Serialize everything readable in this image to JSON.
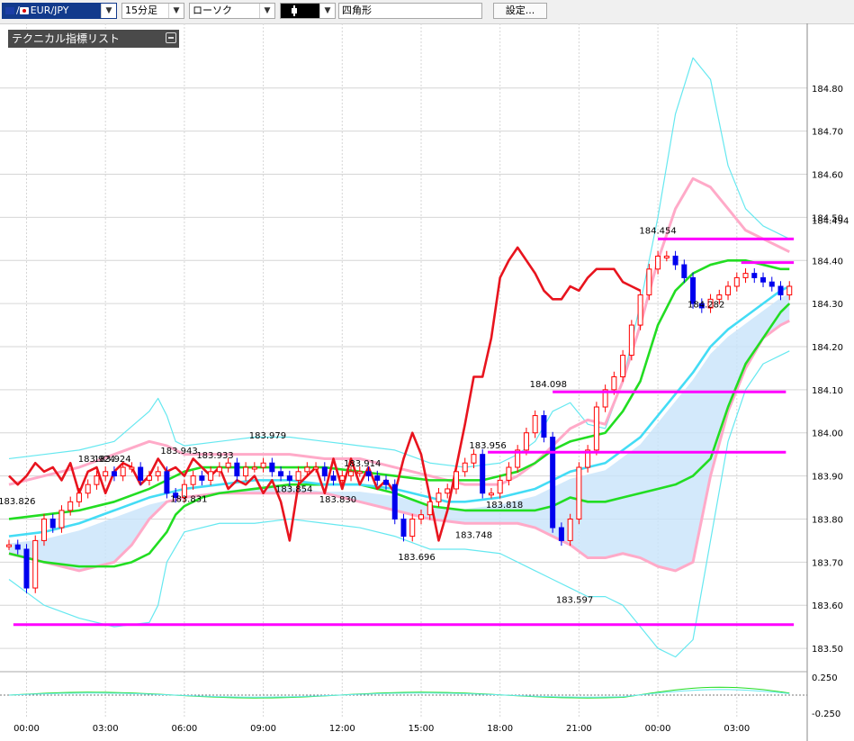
{
  "toolbar": {
    "pair": "EUR/JPY",
    "pair_flag_separator": "/",
    "timeframe": "15分足",
    "chart_style": "ローソク",
    "drawing_tool_icon": "bar-cursor-icon",
    "drawing_shape": "四角形",
    "settings_label": "設定..."
  },
  "indicator_panel": {
    "title": "テクニカル指標リスト"
  },
  "colors": {
    "price_line": "#e8141e",
    "bollinger_inner": "#ffaac8",
    "bollinger_outer": "#66e8f0",
    "ema_green": "#22dd22",
    "ema_cyan": "#44dcf5",
    "horizontal_lines": "#ff00ff",
    "cloud": "#c8e4fa",
    "candle_up": "#ff0000",
    "candle_down": "#0000ee"
  },
  "chart_data": {
    "type": "line",
    "title": "",
    "xlabel": "",
    "ylabel": "",
    "ylim": [
      183.45,
      184.95
    ],
    "yticks": [
      "184.80",
      "184.70",
      "184.60",
      "184.50",
      "184.40",
      "184.30",
      "184.20",
      "184.10",
      "184.00",
      "183.90",
      "183.80",
      "183.70",
      "183.60",
      "183.50"
    ],
    "current_price_label": "184.494",
    "xticks": [
      "00:00",
      "03:00",
      "06:00",
      "09:00",
      "12:00",
      "15:00",
      "18:00",
      "21:00",
      "00:00",
      "03:00"
    ],
    "xtick_pos": [
      2,
      11,
      20,
      29,
      38,
      47,
      56,
      65,
      74,
      83
    ],
    "x_max": 90,
    "oscillator": {
      "yticks": [
        "0.250",
        "-0.250"
      ],
      "ylim": [
        -0.3,
        0.3
      ]
    },
    "horizontal_levels": [
      {
        "from": 0.5,
        "to": 89.5,
        "y": 183.555
      },
      {
        "from": 54.6,
        "to": 88.6,
        "y": 183.955
      },
      {
        "from": 62.0,
        "to": 88.6,
        "y": 184.095
      },
      {
        "from": 74.0,
        "to": 89.5,
        "y": 184.45
      },
      {
        "from": 83.5,
        "to": 89.5,
        "y": 184.395
      }
    ],
    "annotations": [
      {
        "text": "183.826",
        "x": 0.9,
        "y": 183.826
      },
      {
        "text": "183.924",
        "x": 10.0,
        "y": 183.924
      },
      {
        "text": "183.924",
        "x": 11.8,
        "y": 183.924
      },
      {
        "text": "183.943",
        "x": 19.4,
        "y": 183.943
      },
      {
        "text": "183.933",
        "x": 23.5,
        "y": 183.933
      },
      {
        "text": "183.831",
        "x": 20.5,
        "y": 183.831
      },
      {
        "text": "183.979",
        "x": 29.5,
        "y": 183.979
      },
      {
        "text": "183.854",
        "x": 32.5,
        "y": 183.854
      },
      {
        "text": "183.914",
        "x": 40.3,
        "y": 183.914
      },
      {
        "text": "183.830",
        "x": 37.5,
        "y": 183.83
      },
      {
        "text": "183.696",
        "x": 46.5,
        "y": 183.696
      },
      {
        "text": "183.748",
        "x": 53.0,
        "y": 183.748
      },
      {
        "text": "183.956",
        "x": 54.6,
        "y": 183.956
      },
      {
        "text": "183.818",
        "x": 56.5,
        "y": 183.818
      },
      {
        "text": "184.098",
        "x": 61.5,
        "y": 184.098
      },
      {
        "text": "183.597",
        "x": 64.5,
        "y": 183.597
      },
      {
        "text": "184.454",
        "x": 74.0,
        "y": 184.454
      },
      {
        "text": "184.282",
        "x": 79.5,
        "y": 184.282
      }
    ],
    "series": [
      {
        "role": "bb_outer_upper",
        "x": [
          0,
          4,
          8,
          12,
          16,
          17,
          18,
          19,
          20,
          24,
          28,
          32,
          36,
          40,
          44,
          48,
          52,
          56,
          58,
          60,
          62,
          64,
          66,
          68,
          70,
          72,
          74,
          76,
          78,
          80,
          82,
          84,
          86,
          88,
          89
        ],
        "values": [
          183.94,
          183.95,
          183.96,
          183.98,
          184.05,
          184.08,
          184.04,
          183.98,
          183.97,
          183.98,
          183.99,
          183.99,
          183.98,
          183.97,
          183.96,
          183.93,
          183.92,
          183.93,
          183.95,
          183.98,
          184.05,
          184.07,
          184.02,
          184.01,
          184.12,
          184.3,
          184.5,
          184.74,
          184.87,
          184.82,
          184.62,
          184.52,
          184.48,
          184.46,
          184.45
        ]
      },
      {
        "role": "bb_inner_upper",
        "x": [
          0,
          4,
          8,
          12,
          16,
          18,
          20,
          24,
          28,
          32,
          36,
          40,
          44,
          48,
          52,
          56,
          58,
          60,
          62,
          64,
          66,
          68,
          70,
          72,
          74,
          76,
          78,
          80,
          82,
          84,
          86,
          88,
          89
        ],
        "values": [
          183.88,
          183.9,
          183.92,
          183.95,
          183.98,
          183.97,
          183.95,
          183.95,
          183.95,
          183.95,
          183.94,
          183.94,
          183.92,
          183.9,
          183.88,
          183.88,
          183.9,
          183.93,
          183.97,
          184.01,
          184.03,
          184.02,
          184.12,
          184.25,
          184.4,
          184.52,
          184.59,
          184.57,
          184.52,
          184.47,
          184.45,
          184.43,
          184.42
        ]
      },
      {
        "role": "bb_inner_lower",
        "x": [
          0,
          4,
          8,
          12,
          14,
          16,
          18,
          20,
          24,
          28,
          32,
          36,
          40,
          44,
          48,
          52,
          56,
          58,
          60,
          62,
          64,
          66,
          68,
          70,
          72,
          74,
          76,
          78,
          80,
          82,
          84,
          86,
          88,
          89
        ],
        "values": [
          183.72,
          183.7,
          183.68,
          183.7,
          183.74,
          183.8,
          183.84,
          183.85,
          183.86,
          183.86,
          183.86,
          183.86,
          183.84,
          183.82,
          183.8,
          183.79,
          183.79,
          183.79,
          183.78,
          183.76,
          183.74,
          183.71,
          183.71,
          183.72,
          183.71,
          183.69,
          183.68,
          183.7,
          183.9,
          184.05,
          184.15,
          184.22,
          184.25,
          184.26
        ]
      },
      {
        "role": "bb_outer_lower",
        "x": [
          0,
          4,
          8,
          12,
          16,
          17,
          18,
          20,
          24,
          28,
          32,
          36,
          40,
          44,
          48,
          52,
          56,
          58,
          60,
          62,
          64,
          66,
          68,
          70,
          72,
          74,
          76,
          78,
          80,
          82,
          84,
          86,
          88,
          89
        ],
        "values": [
          183.66,
          183.6,
          183.57,
          183.55,
          183.56,
          183.6,
          183.7,
          183.77,
          183.79,
          183.79,
          183.8,
          183.79,
          183.78,
          183.76,
          183.73,
          183.73,
          183.72,
          183.7,
          183.68,
          183.66,
          183.64,
          183.62,
          183.62,
          183.6,
          183.55,
          183.5,
          183.48,
          183.52,
          183.75,
          183.98,
          184.1,
          184.16,
          184.18,
          184.19
        ]
      },
      {
        "role": "ema_green_fast",
        "x": [
          0,
          4,
          8,
          12,
          16,
          18,
          20,
          22,
          24,
          28,
          32,
          36,
          40,
          44,
          48,
          52,
          54,
          56,
          58,
          60,
          62,
          64,
          66,
          68,
          70,
          72,
          74,
          76,
          78,
          80,
          82,
          84,
          86,
          88,
          89
        ],
        "values": [
          183.8,
          183.81,
          183.82,
          183.84,
          183.87,
          183.89,
          183.91,
          183.92,
          183.92,
          183.92,
          183.92,
          183.92,
          183.91,
          183.9,
          183.89,
          183.89,
          183.89,
          183.9,
          183.91,
          183.93,
          183.96,
          183.98,
          183.99,
          184.0,
          184.05,
          184.12,
          184.25,
          184.33,
          184.37,
          184.39,
          184.4,
          184.4,
          184.39,
          184.38,
          184.38
        ]
      },
      {
        "role": "ema_green_slow",
        "x": [
          0,
          4,
          8,
          12,
          14,
          16,
          18,
          19,
          20,
          22,
          24,
          28,
          32,
          36,
          40,
          44,
          48,
          52,
          56,
          58,
          60,
          62,
          64,
          66,
          68,
          70,
          72,
          74,
          76,
          78,
          80,
          82,
          84,
          86,
          88,
          89
        ],
        "values": [
          183.72,
          183.7,
          183.69,
          183.69,
          183.7,
          183.72,
          183.77,
          183.81,
          183.83,
          183.85,
          183.86,
          183.87,
          183.88,
          183.88,
          183.88,
          183.86,
          183.83,
          183.82,
          183.82,
          183.82,
          183.82,
          183.83,
          183.85,
          183.84,
          183.84,
          183.85,
          183.86,
          183.87,
          183.88,
          183.9,
          183.94,
          184.06,
          184.16,
          184.22,
          184.28,
          184.3
        ]
      },
      {
        "role": "ema_cyan",
        "x": [
          0,
          4,
          8,
          12,
          16,
          20,
          24,
          28,
          32,
          36,
          40,
          44,
          48,
          50,
          52,
          56,
          58,
          60,
          62,
          64,
          66,
          68,
          70,
          72,
          74,
          76,
          78,
          80,
          82,
          84,
          86,
          88,
          89
        ],
        "values": [
          183.76,
          183.77,
          183.79,
          183.82,
          183.85,
          183.87,
          183.88,
          183.89,
          183.89,
          183.88,
          183.88,
          183.87,
          183.85,
          183.84,
          183.84,
          183.85,
          183.86,
          183.87,
          183.89,
          183.91,
          183.92,
          183.93,
          183.96,
          183.99,
          184.04,
          184.09,
          184.14,
          184.2,
          184.24,
          184.27,
          184.3,
          184.33,
          184.34
        ]
      },
      {
        "role": "price_line_red",
        "x": [
          0,
          1,
          2,
          3,
          4,
          5,
          6,
          7,
          8,
          9,
          10,
          11,
          12,
          13,
          14,
          15,
          16,
          17,
          18,
          19,
          20,
          21,
          22,
          23,
          24,
          25,
          26,
          27,
          28,
          29,
          30,
          31,
          32,
          33,
          34,
          35,
          36,
          37,
          38,
          39,
          40,
          41,
          42,
          43,
          44,
          45,
          46,
          47,
          48,
          49,
          50,
          51,
          52,
          53,
          54,
          55,
          56,
          57,
          58,
          59,
          60,
          61,
          62,
          63,
          64,
          65,
          66,
          67,
          68,
          69,
          70,
          71,
          72
        ],
        "values": [
          183.9,
          183.88,
          183.9,
          183.93,
          183.91,
          183.92,
          183.89,
          183.93,
          183.86,
          183.91,
          183.92,
          183.86,
          183.91,
          183.93,
          183.92,
          183.88,
          183.9,
          183.94,
          183.91,
          183.92,
          183.9,
          183.94,
          183.92,
          183.9,
          183.92,
          183.87,
          183.89,
          183.88,
          183.9,
          183.86,
          183.89,
          183.84,
          183.75,
          183.88,
          183.9,
          183.92,
          183.86,
          183.94,
          183.87,
          183.94,
          183.88,
          183.92,
          183.87,
          183.89,
          183.86,
          183.94,
          184.0,
          183.95,
          183.85,
          183.75,
          183.82,
          183.92,
          184.02,
          184.13,
          184.13,
          184.22,
          184.36,
          184.4,
          184.43,
          184.4,
          184.37,
          184.33,
          184.31,
          184.31,
          184.34,
          184.33,
          184.36,
          184.38,
          184.38,
          184.38,
          184.35,
          184.34,
          184.33
        ]
      },
      {
        "role": "candles",
        "x": [
          0,
          1,
          2,
          3,
          4,
          5,
          6,
          7,
          8,
          9,
          10,
          11,
          12,
          13,
          14,
          15,
          16,
          17,
          18,
          19,
          20,
          21,
          22,
          23,
          24,
          25,
          26,
          27,
          28,
          29,
          30,
          31,
          32,
          33,
          34,
          35,
          36,
          37,
          38,
          39,
          40,
          41,
          42,
          43,
          44,
          45,
          46,
          47,
          48,
          49,
          50,
          51,
          52,
          53,
          54,
          55,
          56,
          57,
          58,
          59,
          60,
          61,
          62,
          63,
          64,
          65,
          66,
          67,
          68,
          69,
          70,
          71,
          72,
          73,
          74,
          75,
          76,
          77,
          78,
          79,
          80,
          81,
          82,
          83,
          84,
          85,
          86,
          87,
          88,
          89
        ],
        "values": [
          183.74,
          183.73,
          183.64,
          183.75,
          183.8,
          183.78,
          183.82,
          183.84,
          183.86,
          183.88,
          183.9,
          183.91,
          183.9,
          183.92,
          183.92,
          183.89,
          183.9,
          183.91,
          183.86,
          183.85,
          183.88,
          183.9,
          183.89,
          183.91,
          183.92,
          183.93,
          183.9,
          183.92,
          183.92,
          183.93,
          183.91,
          183.9,
          183.89,
          183.91,
          183.92,
          183.92,
          183.9,
          183.89,
          183.9,
          183.91,
          183.91,
          183.9,
          183.89,
          183.88,
          183.8,
          183.76,
          183.8,
          183.81,
          183.84,
          183.86,
          183.87,
          183.91,
          183.93,
          183.95,
          183.86,
          183.86,
          183.89,
          183.92,
          183.96,
          184.0,
          184.04,
          183.99,
          183.78,
          183.75,
          183.8,
          183.92,
          183.96,
          184.06,
          184.1,
          184.13,
          184.18,
          184.25,
          184.32,
          184.38,
          184.41,
          184.41,
          184.39,
          184.36,
          184.3,
          184.29,
          184.31,
          184.32,
          184.34,
          184.36,
          184.37,
          184.36,
          184.35,
          184.34,
          184.32,
          184.34
        ]
      }
    ]
  }
}
